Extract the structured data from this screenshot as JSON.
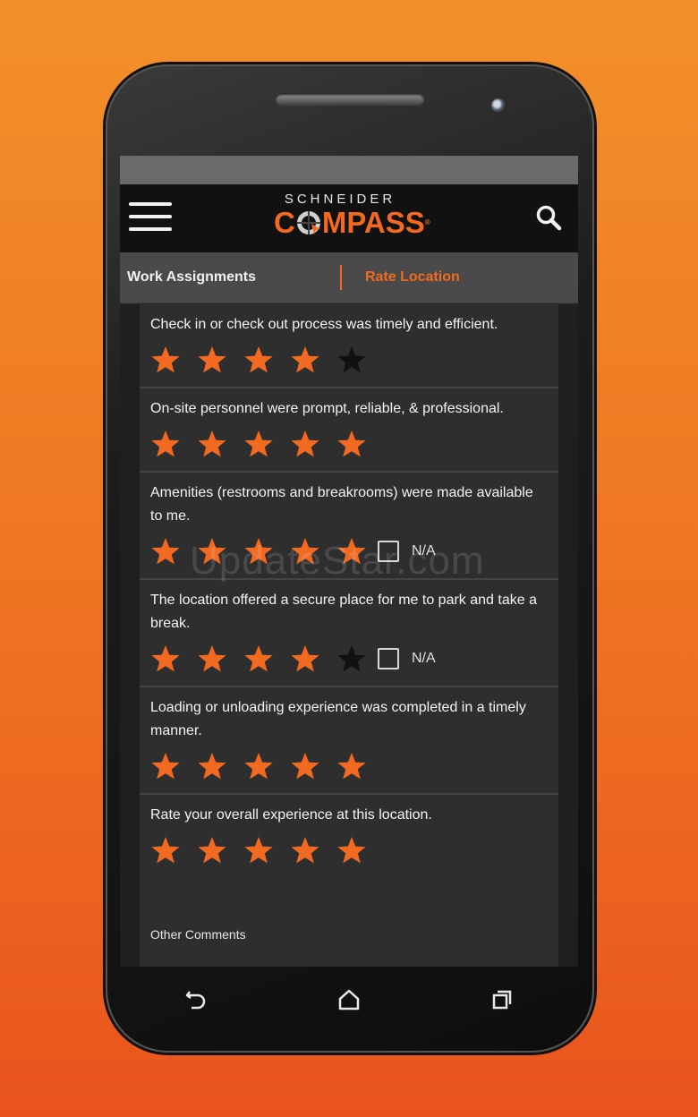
{
  "header": {
    "logo_top": "SCHNEIDER",
    "logo_main_a": "C",
    "logo_main_b": "MPASS",
    "logo_reg": "®",
    "menu_icon": "hamburger-menu-icon",
    "search_icon": "search-icon"
  },
  "tabs": [
    {
      "label": "Work Assignments",
      "active": false
    },
    {
      "label": "Rate Location",
      "active": true
    }
  ],
  "questions": [
    {
      "text": "Check in or check out process was timely and efficient.",
      "rating": 4,
      "max": 5,
      "has_na": false
    },
    {
      "text": "On-site personnel were prompt, reliable, & professional.",
      "rating": 5,
      "max": 5,
      "has_na": false
    },
    {
      "text": "Amenities (restrooms and breakrooms) were made available to me.",
      "rating": 5,
      "max": 5,
      "has_na": true,
      "na_label": "N/A"
    },
    {
      "text": "The location offered a secure place for me to park and take a break.",
      "rating": 4,
      "max": 5,
      "has_na": true,
      "na_label": "N/A"
    },
    {
      "text": "Loading or unloading experience was completed in a timely manner.",
      "rating": 5,
      "max": 5,
      "has_na": false
    },
    {
      "text": "Rate your overall experience at this location.",
      "rating": 5,
      "max": 5,
      "has_na": false
    }
  ],
  "comments": {
    "label": "Other Comments"
  },
  "watermark": "UpdateStar.com",
  "colors": {
    "accent": "#f26a21",
    "star_on": "#f26a21",
    "star_off": "#111111"
  },
  "navbar": [
    "back-icon",
    "home-icon",
    "recents-icon"
  ]
}
